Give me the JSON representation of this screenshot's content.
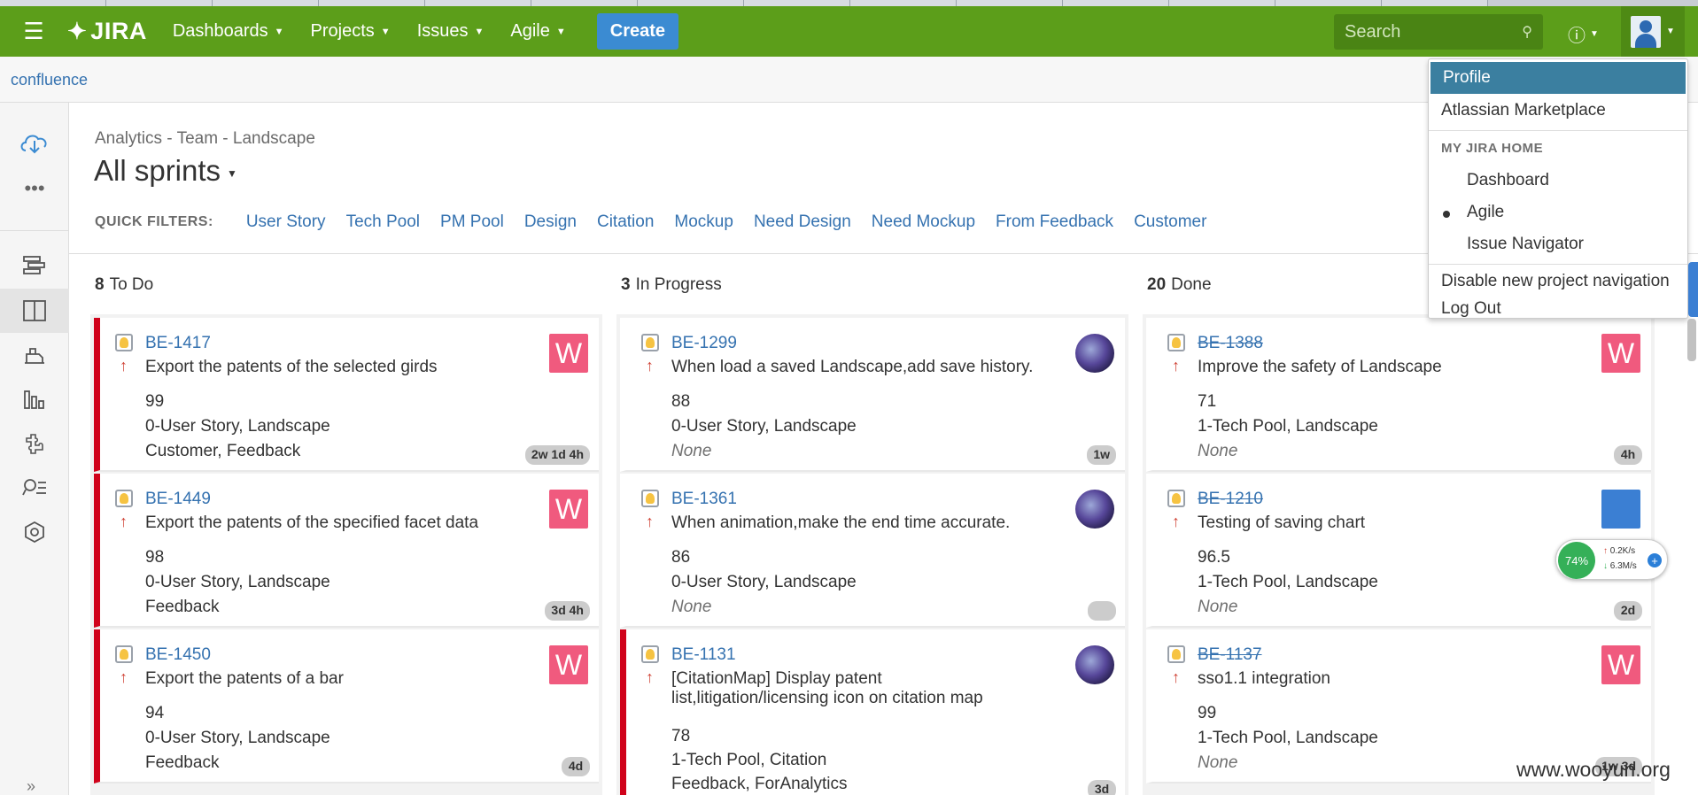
{
  "nav": {
    "logo": "JIRA",
    "items": [
      {
        "label": "Dashboards"
      },
      {
        "label": "Projects"
      },
      {
        "label": "Issues"
      },
      {
        "label": "Agile"
      }
    ],
    "create": "Create",
    "search_placeholder": "Search",
    "help_icon": "help-icon",
    "brand_color": "#5c9e1a"
  },
  "appbar": {
    "link": "confluence"
  },
  "board": {
    "breadcrumb": "Analytics - Team - Landscape",
    "title": "All sprints",
    "quick_filters_label": "QUICK FILTERS:",
    "quick_filters": [
      "User Story",
      "Tech Pool",
      "PM Pool",
      "Design",
      "Citation",
      "Mockup",
      "Need Design",
      "Need Mockup",
      "From Feedback",
      "Customer"
    ]
  },
  "columns": [
    {
      "count": "8",
      "name": "To Do",
      "cards": [
        {
          "key": "BE-1417",
          "summary": "Export the patents of the selected girds",
          "points": "99",
          "labels": "0-User Story, Landscape",
          "extra": "Customer, Feedback",
          "estimate": "2w 1d 4h",
          "avatar": "W"
        },
        {
          "key": "BE-1449",
          "summary": "Export the patents of the specified facet data",
          "points": "98",
          "labels": "0-User Story, Landscape",
          "extra": "Feedback",
          "estimate": "3d 4h",
          "avatar": "W"
        },
        {
          "key": "BE-1450",
          "summary": "Export the patents of a bar",
          "points": "94",
          "labels": "0-User Story, Landscape",
          "extra": "Feedback",
          "estimate": "4d",
          "avatar": "W"
        }
      ]
    },
    {
      "count": "3",
      "name": "In Progress",
      "cards": [
        {
          "key": "BE-1299",
          "summary": "When load a saved Landscape,add save history.",
          "points": "88",
          "labels": "0-User Story, Landscape",
          "extra": "None",
          "estimate": "1w"
        },
        {
          "key": "BE-1361",
          "summary": "When animation,make the end time accurate.",
          "points": "86",
          "labels": "0-User Story, Landscape",
          "extra": "None",
          "estimate": ""
        },
        {
          "key": "BE-1131",
          "summary": "[CitationMap] Display patent list,litigation/licensing icon on citation map",
          "points": "78",
          "labels": "1-Tech Pool, Citation",
          "extra": "Feedback, ForAnalytics",
          "estimate": "3d"
        }
      ]
    },
    {
      "count": "20",
      "name": "Done",
      "cards": [
        {
          "key": "BE-1388",
          "summary": "Improve the safety of Landscape",
          "points": "71",
          "labels": "1-Tech Pool, Landscape",
          "extra": "None",
          "estimate": "4h",
          "avatar": "W"
        },
        {
          "key": "BE-1210",
          "summary": "Testing of saving chart",
          "points": "96.5",
          "labels": "1-Tech Pool, Landscape",
          "extra": "None",
          "estimate": "2d"
        },
        {
          "key": "BE-1137",
          "summary": "sso1.1 integration",
          "points": "99",
          "labels": "1-Tech Pool, Landscape",
          "extra": "None",
          "estimate": "1w 3d",
          "avatar": "W"
        }
      ]
    }
  ],
  "user_menu": {
    "profile": "Profile",
    "marketplace": "Atlassian Marketplace",
    "home_heading": "MY JIRA HOME",
    "home_options": [
      "Dashboard",
      "Agile",
      "Issue Navigator"
    ],
    "selected_home": "Agile",
    "disable_nav": "Disable new project navigation",
    "logout": "Log Out"
  },
  "widget": {
    "percent": "74%",
    "up": "0.2K/s",
    "down": "6.3M/s"
  },
  "watermark": "www.wooyun.org"
}
